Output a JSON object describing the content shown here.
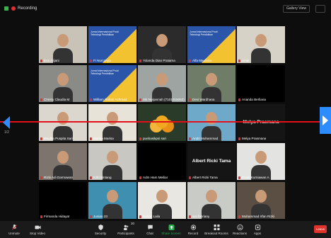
{
  "topbar": {
    "recording_label": "Recording",
    "view_label": "Gallery View"
  },
  "banner_tile_text": "Jurnal Internasional Prodi Teknologi Pendidikan",
  "page_number": "1/2",
  "participants": [
    {
      "name": "Eva Arijani",
      "bg": "#c9c2b6",
      "style": "person"
    },
    {
      "name": "Fi Nurcahya",
      "bg": "#2a55a8",
      "style": "banner"
    },
    {
      "name": "Yolanda Dian Pratama",
      "bg": "#2b2b2b",
      "style": "person"
    },
    {
      "name": "Alfa Maulana",
      "bg": "#3657a6",
      "style": "banner"
    },
    {
      "name": "Amin",
      "bg": "#d7d2c7",
      "style": "person"
    },
    {
      "name": "Christy Claudia M",
      "bg": "#8a8a86",
      "style": "person"
    },
    {
      "name": "William Rafiah Achmad",
      "bg": "#2a55a8",
      "style": "banner"
    },
    {
      "name": "Siti Nurjannah (7101015062)",
      "bg": "#9ea4a2",
      "style": "person"
    },
    {
      "name": "Devi Wardhana",
      "bg": "#6f7c68",
      "style": "person"
    },
    {
      "name": "Ananda Berliana",
      "bg": "#000000",
      "style": "dark"
    },
    {
      "name": "Maulita Puspita Sari",
      "bg": "#dcd7ce",
      "style": "person"
    },
    {
      "name": "Marisa Marisa",
      "bg": "#e8e3d9",
      "style": "person"
    },
    {
      "name": "puebasikpsi sari",
      "bg": "#2b3b2a",
      "style": "flower"
    },
    {
      "name": "Andri Muhammad",
      "bg": "#6fa9c9",
      "style": "person"
    },
    {
      "name": "Melya Prasmana",
      "bg": "#151515",
      "style": "label",
      "big_name": "Melya Prasmana"
    },
    {
      "name": "Rizki Adi Darmawan",
      "bg": "#7d756d",
      "style": "person"
    },
    {
      "name": "Ezki Bintang",
      "bg": "#c9c7c1",
      "style": "person"
    },
    {
      "name": "Adm Ham Meiliar",
      "bg": "#000000",
      "style": "dark"
    },
    {
      "name": "Albert Ricki Tama",
      "bg": "#151515",
      "style": "label",
      "big_name": "Albert Ricki Tama"
    },
    {
      "name": "Erwin Kurniawan A",
      "bg": "#e3e3e1",
      "style": "person"
    },
    {
      "name": "Firmanda Hidayat",
      "bg": "#000000",
      "style": "dark"
    },
    {
      "name": "Junian 23",
      "bg": "#3f8fb0",
      "style": "person"
    },
    {
      "name": "Kahrdi Laila",
      "bg": "#e9e7e2",
      "style": "person"
    },
    {
      "name": "sisi febriany",
      "bg": "#c9cbc7",
      "style": "person"
    },
    {
      "name": "Muhammad Irfan Rizki",
      "bg": "#5b4f43",
      "style": "person"
    }
  ],
  "toolbar": {
    "unmute": "Unmute",
    "stop_video": "Stop Video",
    "security": "Security",
    "participants": "Participants",
    "participants_count": "30",
    "chat": "Chat",
    "share_screen": "Share Screen",
    "record": "Record",
    "breakout_rooms": "Breakout Rooms",
    "reactions": "Reactions",
    "apps": "Apps",
    "leave": "Leave"
  },
  "colors": {
    "accent": "#2d8cff",
    "share": "#22b04b",
    "danger": "#e0332b",
    "annotation_line": "#e3101a"
  }
}
